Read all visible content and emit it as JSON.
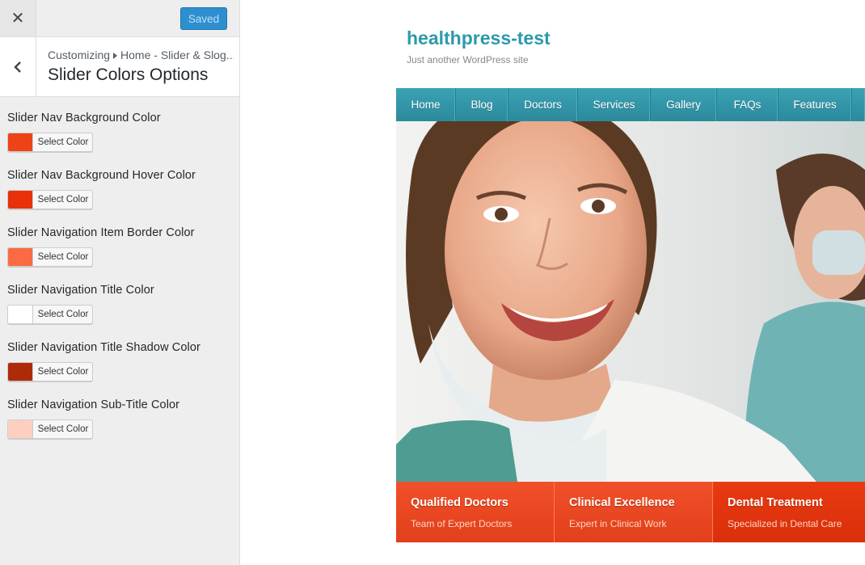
{
  "topbar": {
    "close_icon": "close-icon",
    "close_glyph": "✕",
    "saved_label": "Saved",
    "saved_color": "#2e8fd0"
  },
  "section": {
    "back_icon": "chevron-left-icon",
    "crumb_root": "Customizing",
    "crumb_path": "Home - Slider & Slog...",
    "title": "Slider Colors Options"
  },
  "controls": [
    {
      "label": "Slider Nav Background Color",
      "button": "Select Color",
      "color": "#ee4316"
    },
    {
      "label": "Slider Nav Background Hover Color",
      "button": "Select Color",
      "color": "#e8310a"
    },
    {
      "label": "Slider Navigation Item Border Color",
      "button": "Select Color",
      "color": "#fb6a42"
    },
    {
      "label": "Slider Navigation Title Color",
      "button": "Select Color",
      "color": "#ffffff"
    },
    {
      "label": "Slider Navigation Title Shadow Color",
      "button": "Select Color",
      "color": "#ad2b08"
    },
    {
      "label": "Slider Navigation Sub-Title Color",
      "button": "Select Color",
      "color": "#fdcfc0"
    }
  ],
  "preview": {
    "site_title": "healthpress-test",
    "tagline": "Just another WordPress site",
    "nav": [
      "Home",
      "Blog",
      "Doctors",
      "Services",
      "Gallery",
      "FAQs",
      "Features"
    ],
    "slides": [
      {
        "title": "Qualified Doctors",
        "subtitle": "Team of Expert Doctors"
      },
      {
        "title": "Clinical Excellence",
        "subtitle": "Expert in Clinical Work"
      },
      {
        "title": "Dental Treatment",
        "subtitle": "Specialized in Dental Care"
      }
    ],
    "colors": {
      "site_title": "#2b9aab",
      "nav_bg": "#3399aa",
      "slider_nav_bg": "#ee4316"
    }
  }
}
